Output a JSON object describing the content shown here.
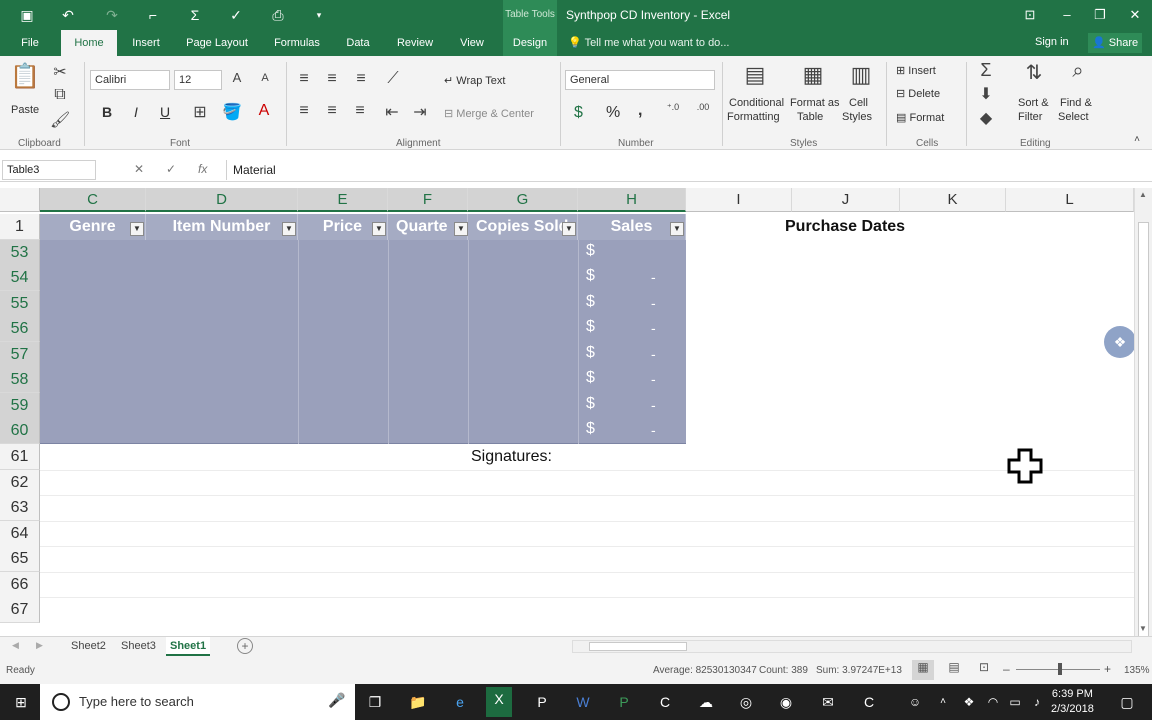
{
  "titlebar": {
    "tool_context": "Table Tools",
    "title": "Synthpop CD Inventory - Excel",
    "qat": [
      "save-icon",
      "undo-icon",
      "redo-icon",
      "sum-icon",
      "spell-check-icon",
      "form-icon"
    ]
  },
  "tabs": [
    {
      "label": "File"
    },
    {
      "label": "Home"
    },
    {
      "label": "Insert"
    },
    {
      "label": "Page Layout"
    },
    {
      "label": "Formulas"
    },
    {
      "label": "Data"
    },
    {
      "label": "Review"
    },
    {
      "label": "View"
    },
    {
      "label": "Design"
    }
  ],
  "tell_me": "Tell me what you want to do...",
  "sign_in": "Sign in",
  "share": "Share",
  "ribbon": {
    "clipboard": {
      "paste": "Paste",
      "label": "Clipboard"
    },
    "font": {
      "name": "Calibri",
      "size": "12",
      "label": "Font",
      "bold": "B",
      "italic": "I",
      "underline": "U"
    },
    "alignment": {
      "wrap_text": "Wrap Text",
      "merge_center": "Merge & Center",
      "label": "Alignment"
    },
    "number": {
      "format": "General",
      "label": "Number",
      "currency": "$",
      "percent": "%",
      "comma": ","
    },
    "styles": {
      "conditional": "Conditional",
      "formatting": "Formatting",
      "format_as": "Format as",
      "table": "Table",
      "cell": "Cell",
      "styles_btn": "Styles",
      "label": "Styles"
    },
    "cells": {
      "insert": "Insert",
      "delete": "Delete",
      "format": "Format",
      "label": "Cells"
    },
    "editing": {
      "sort": "Sort &",
      "filter": "Filter",
      "find": "Find &",
      "select": "Select",
      "label": "Editing"
    }
  },
  "formula_bar": {
    "name_box": "Table3",
    "fx": "fx",
    "content": "Material"
  },
  "grid": {
    "columns": [
      "C",
      "D",
      "E",
      "F",
      "G",
      "H",
      "I",
      "J",
      "K",
      "L"
    ],
    "rows": [
      "1",
      "53",
      "54",
      "55",
      "56",
      "57",
      "58",
      "59",
      "60",
      "61",
      "62",
      "63",
      "64",
      "65",
      "66",
      "67"
    ],
    "table_headers": [
      "Genre",
      "Item Number",
      "Price",
      "Quarte",
      "Copies Sold",
      "Sales"
    ],
    "currency_symbol": "$",
    "dash": "-",
    "purchase_dates": "Purchase Dates",
    "signatures": "Signatures:"
  },
  "sheets": [
    {
      "name": "Sheet2"
    },
    {
      "name": "Sheet3"
    },
    {
      "name": "Sheet1"
    }
  ],
  "status": {
    "ready": "Ready",
    "average": "Average: 82530130347",
    "count": "Count: 389",
    "sum": "Sum: 3.97247E+13",
    "zoom": "135%"
  },
  "taskbar": {
    "search_placeholder": "Type here to search",
    "time": "6:39 PM",
    "date": "2/3/2018"
  },
  "colors": {
    "excel_green": "#217346",
    "table_header": "#a5abc3",
    "selection": "#9aa0bb"
  }
}
